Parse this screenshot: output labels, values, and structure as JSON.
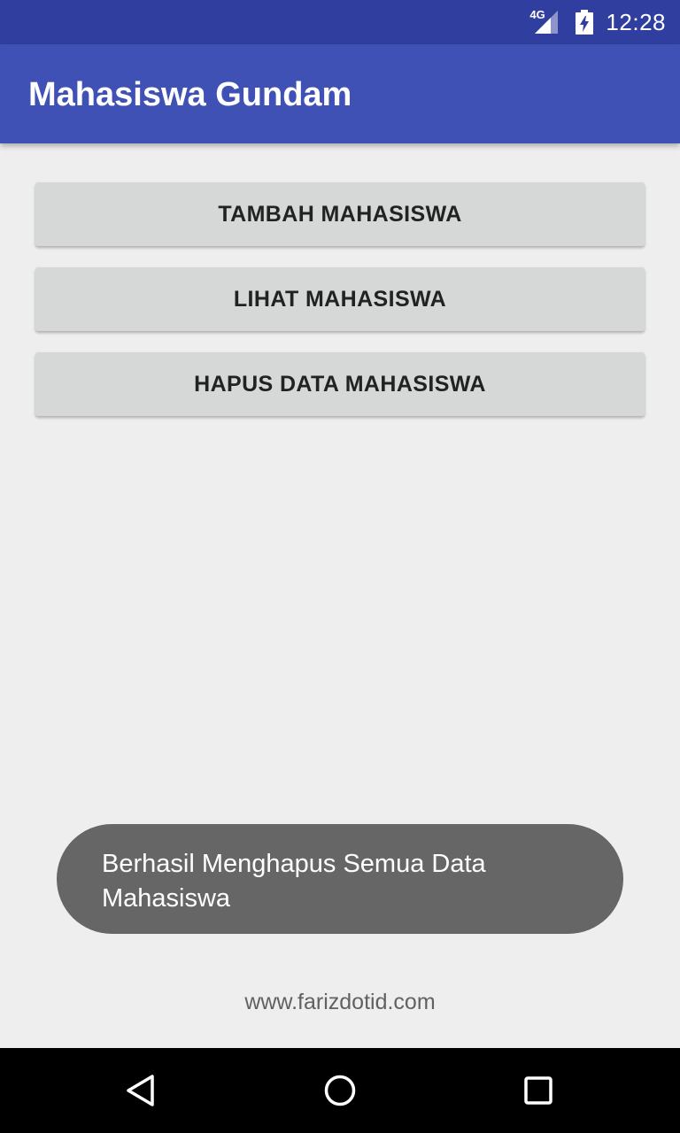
{
  "status_bar": {
    "network": "4G",
    "time": "12:28",
    "icons": [
      "signal-icon",
      "battery-charging-icon"
    ]
  },
  "app_bar": {
    "title": "Mahasiswa Gundam"
  },
  "buttons": {
    "add": "TAMBAH MAHASISWA",
    "view": "LIHAT MAHASISWA",
    "delete": "HAPUS DATA MAHASISWA"
  },
  "toast": {
    "message": "Berhasil Menghapus Semua Data Mahasiswa"
  },
  "footer": {
    "text": "www.farizdotid.com"
  },
  "nav_bar": {
    "icons": [
      "back-icon",
      "home-icon",
      "recent-apps-icon"
    ]
  },
  "colors": {
    "status_bar": "#303f9f",
    "app_bar": "#3f51b5",
    "background": "#eeeeee",
    "button": "#d6d7d7",
    "toast": "#666666",
    "nav_bar": "#000000"
  }
}
